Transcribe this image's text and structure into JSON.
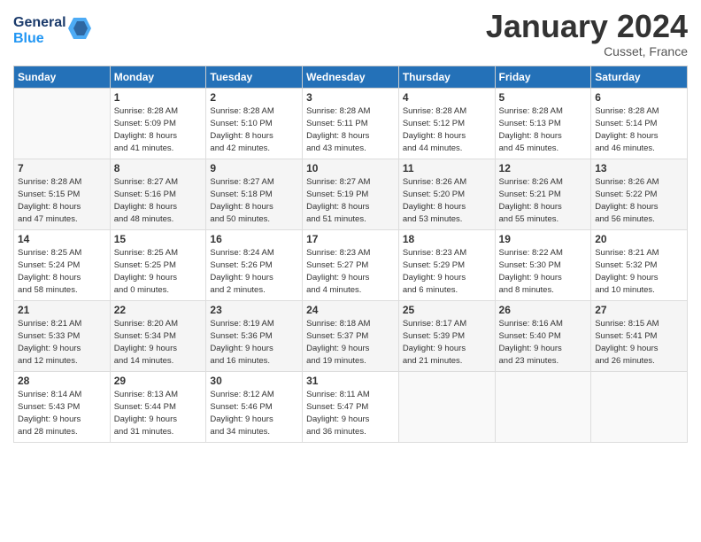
{
  "logo": {
    "line1": "General",
    "line2": "Blue"
  },
  "header": {
    "title": "January 2024",
    "location": "Cusset, France"
  },
  "weekdays": [
    "Sunday",
    "Monday",
    "Tuesday",
    "Wednesday",
    "Thursday",
    "Friday",
    "Saturday"
  ],
  "weeks": [
    [
      {
        "day": "",
        "info": ""
      },
      {
        "day": "1",
        "info": "Sunrise: 8:28 AM\nSunset: 5:09 PM\nDaylight: 8 hours\nand 41 minutes."
      },
      {
        "day": "2",
        "info": "Sunrise: 8:28 AM\nSunset: 5:10 PM\nDaylight: 8 hours\nand 42 minutes."
      },
      {
        "day": "3",
        "info": "Sunrise: 8:28 AM\nSunset: 5:11 PM\nDaylight: 8 hours\nand 43 minutes."
      },
      {
        "day": "4",
        "info": "Sunrise: 8:28 AM\nSunset: 5:12 PM\nDaylight: 8 hours\nand 44 minutes."
      },
      {
        "day": "5",
        "info": "Sunrise: 8:28 AM\nSunset: 5:13 PM\nDaylight: 8 hours\nand 45 minutes."
      },
      {
        "day": "6",
        "info": "Sunrise: 8:28 AM\nSunset: 5:14 PM\nDaylight: 8 hours\nand 46 minutes."
      }
    ],
    [
      {
        "day": "7",
        "info": "Sunrise: 8:28 AM\nSunset: 5:15 PM\nDaylight: 8 hours\nand 47 minutes."
      },
      {
        "day": "8",
        "info": "Sunrise: 8:27 AM\nSunset: 5:16 PM\nDaylight: 8 hours\nand 48 minutes."
      },
      {
        "day": "9",
        "info": "Sunrise: 8:27 AM\nSunset: 5:18 PM\nDaylight: 8 hours\nand 50 minutes."
      },
      {
        "day": "10",
        "info": "Sunrise: 8:27 AM\nSunset: 5:19 PM\nDaylight: 8 hours\nand 51 minutes."
      },
      {
        "day": "11",
        "info": "Sunrise: 8:26 AM\nSunset: 5:20 PM\nDaylight: 8 hours\nand 53 minutes."
      },
      {
        "day": "12",
        "info": "Sunrise: 8:26 AM\nSunset: 5:21 PM\nDaylight: 8 hours\nand 55 minutes."
      },
      {
        "day": "13",
        "info": "Sunrise: 8:26 AM\nSunset: 5:22 PM\nDaylight: 8 hours\nand 56 minutes."
      }
    ],
    [
      {
        "day": "14",
        "info": "Sunrise: 8:25 AM\nSunset: 5:24 PM\nDaylight: 8 hours\nand 58 minutes."
      },
      {
        "day": "15",
        "info": "Sunrise: 8:25 AM\nSunset: 5:25 PM\nDaylight: 9 hours\nand 0 minutes."
      },
      {
        "day": "16",
        "info": "Sunrise: 8:24 AM\nSunset: 5:26 PM\nDaylight: 9 hours\nand 2 minutes."
      },
      {
        "day": "17",
        "info": "Sunrise: 8:23 AM\nSunset: 5:27 PM\nDaylight: 9 hours\nand 4 minutes."
      },
      {
        "day": "18",
        "info": "Sunrise: 8:23 AM\nSunset: 5:29 PM\nDaylight: 9 hours\nand 6 minutes."
      },
      {
        "day": "19",
        "info": "Sunrise: 8:22 AM\nSunset: 5:30 PM\nDaylight: 9 hours\nand 8 minutes."
      },
      {
        "day": "20",
        "info": "Sunrise: 8:21 AM\nSunset: 5:32 PM\nDaylight: 9 hours\nand 10 minutes."
      }
    ],
    [
      {
        "day": "21",
        "info": "Sunrise: 8:21 AM\nSunset: 5:33 PM\nDaylight: 9 hours\nand 12 minutes."
      },
      {
        "day": "22",
        "info": "Sunrise: 8:20 AM\nSunset: 5:34 PM\nDaylight: 9 hours\nand 14 minutes."
      },
      {
        "day": "23",
        "info": "Sunrise: 8:19 AM\nSunset: 5:36 PM\nDaylight: 9 hours\nand 16 minutes."
      },
      {
        "day": "24",
        "info": "Sunrise: 8:18 AM\nSunset: 5:37 PM\nDaylight: 9 hours\nand 19 minutes."
      },
      {
        "day": "25",
        "info": "Sunrise: 8:17 AM\nSunset: 5:39 PM\nDaylight: 9 hours\nand 21 minutes."
      },
      {
        "day": "26",
        "info": "Sunrise: 8:16 AM\nSunset: 5:40 PM\nDaylight: 9 hours\nand 23 minutes."
      },
      {
        "day": "27",
        "info": "Sunrise: 8:15 AM\nSunset: 5:41 PM\nDaylight: 9 hours\nand 26 minutes."
      }
    ],
    [
      {
        "day": "28",
        "info": "Sunrise: 8:14 AM\nSunset: 5:43 PM\nDaylight: 9 hours\nand 28 minutes."
      },
      {
        "day": "29",
        "info": "Sunrise: 8:13 AM\nSunset: 5:44 PM\nDaylight: 9 hours\nand 31 minutes."
      },
      {
        "day": "30",
        "info": "Sunrise: 8:12 AM\nSunset: 5:46 PM\nDaylight: 9 hours\nand 34 minutes."
      },
      {
        "day": "31",
        "info": "Sunrise: 8:11 AM\nSunset: 5:47 PM\nDaylight: 9 hours\nand 36 minutes."
      },
      {
        "day": "",
        "info": ""
      },
      {
        "day": "",
        "info": ""
      },
      {
        "day": "",
        "info": ""
      }
    ]
  ]
}
